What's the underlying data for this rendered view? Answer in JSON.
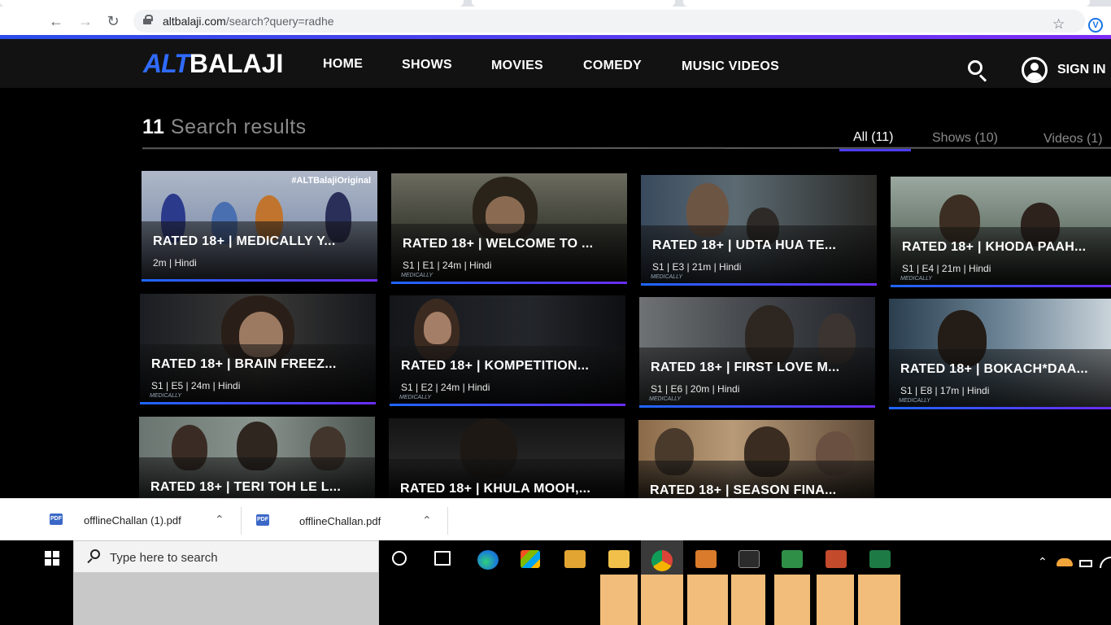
{
  "browser": {
    "url_host": "altbalaji.com",
    "url_path": "/search?query=radhe",
    "ext_label": "V"
  },
  "site": {
    "logo_alt": "ALT",
    "logo_balaji": "BALAJI",
    "nav": [
      "HOME",
      "SHOWS",
      "MOVIES",
      "COMEDY",
      "MUSIC VIDEOS"
    ],
    "sign_in": "SIGN IN"
  },
  "results": {
    "count": "11",
    "label": "Search results",
    "filters": [
      "All (11)",
      "Shows (10)",
      "Videos (1)"
    ]
  },
  "cards": [
    {
      "title": "RATED 18+ | MEDICALLY Y...",
      "meta": "2m | Hindi",
      "tag": "#ALTBalajiOriginal"
    },
    {
      "title": "RATED 18+ | WELCOME TO ...",
      "meta": "S1 | E1 | 24m | Hindi"
    },
    {
      "title": "RATED 18+ | UDTA HUA TE...",
      "meta": "S1 | E3 | 21m | Hindi"
    },
    {
      "title": "RATED 18+ | KHODA PAAH...",
      "meta": "S1 | E4 | 21m | Hindi"
    },
    {
      "title": "RATED 18+ | BRAIN FREEZ...",
      "meta": "S1 | E5 | 24m | Hindi"
    },
    {
      "title": "RATED 18+ | KOMPETITION...",
      "meta": "S1 | E2 | 24m | Hindi"
    },
    {
      "title": "RATED 18+ | FIRST LOVE M...",
      "meta": "S1 | E6 | 20m | Hindi"
    },
    {
      "title": "RATED 18+ | BOKACH*DAA...",
      "meta": "S1 | E8 | 17m | Hindi"
    },
    {
      "title": "RATED 18+ | TERI TOH LE L...",
      "meta": ""
    },
    {
      "title": "RATED 18+ | KHULA MOOH,...",
      "meta": ""
    },
    {
      "title": "RATED 18+ | SEASON FINA...",
      "meta": ""
    }
  ],
  "downloads": [
    {
      "icon": "PDF",
      "name": "offlineChallan (1).pdf"
    },
    {
      "icon": "PDF",
      "name": "offlineChallan.pdf"
    }
  ],
  "taskbar": {
    "search_placeholder": "Type here to search"
  },
  "colors": {
    "accent_blue": "#2f6bff",
    "accent_purple": "#6a2cf5",
    "header_bg": "#121212"
  }
}
